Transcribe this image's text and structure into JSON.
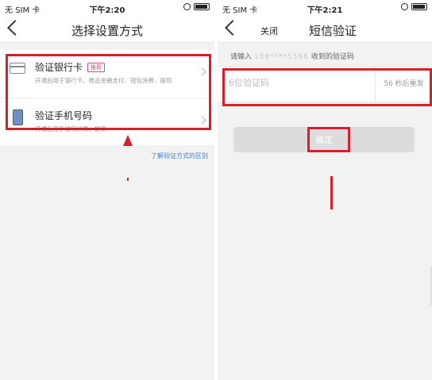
{
  "left": {
    "status": {
      "carrier": "无 SIM 卡",
      "time": "下午2:20"
    },
    "title": "选择设置方式",
    "options": [
      {
        "title": "验证银行卡",
        "badge": "推荐",
        "subtitle": "开通后用于银行卡、唯品金融支付、钱包消费、提现"
      },
      {
        "title": "验证手机号码",
        "subtitle": "开通后用于钱包消费、提现"
      }
    ],
    "link": "了解验证方式的区别"
  },
  "right": {
    "status": {
      "carrier": "无 SIM 卡",
      "time": "下午2:21"
    },
    "close_label": "关闭",
    "title": "短信验证",
    "hint_prefix": "请输入",
    "hint_masked": "188****5566",
    "hint_suffix": "收到的验证码",
    "code_placeholder": "6位验证码",
    "resend": "56 秒后重发",
    "confirm": "确定"
  },
  "colors": {
    "annotation": "#d81e28",
    "link": "#3a86d8",
    "badge": "#e0467a",
    "button_disabled": "#dcdcdc"
  },
  "icons": [
    "back-icon",
    "bank-card-icon",
    "phone-icon",
    "chevron-right-icon",
    "wifi-icon",
    "battery-icon"
  ]
}
